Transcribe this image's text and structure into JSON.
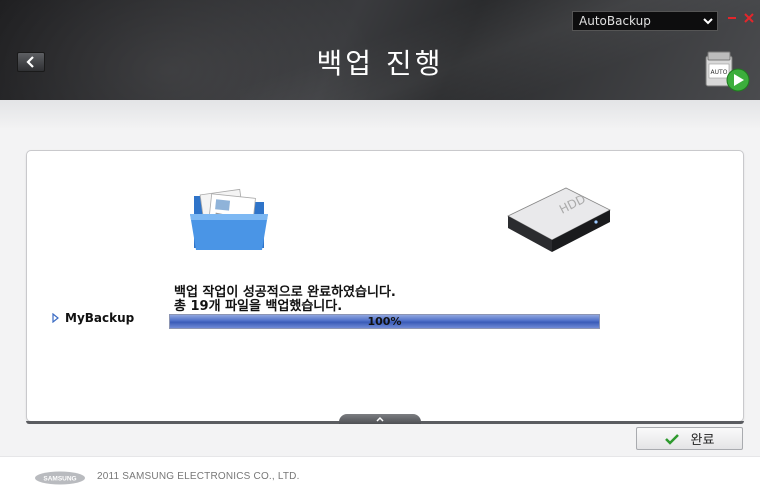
{
  "header": {
    "title": "백업 진행",
    "mode_select": {
      "value": "AutoBackup"
    },
    "auto_icon_label": "AUTO"
  },
  "task": {
    "message_line1": "백업 작업이 성공적으로 완료하였습니다.",
    "message_line2": "총 19개 파일을 백업했습니다.",
    "item_label": "MyBackup",
    "progress_value": 1.0,
    "progress_text": "100%",
    "hdd_label": "HDD"
  },
  "buttons": {
    "finish_label": "완료"
  },
  "footer": {
    "logo_text": "SAMSUNG",
    "copyright": "2011 SAMSUNG ELECTRONICS CO., LTD."
  },
  "colors": {
    "header_dark": "#2a2b2d",
    "progress_blue": "#4e6fc8",
    "close_red": "#e3262b",
    "checkmark_green": "#2e9a2e",
    "play_green": "#3cae3c"
  }
}
